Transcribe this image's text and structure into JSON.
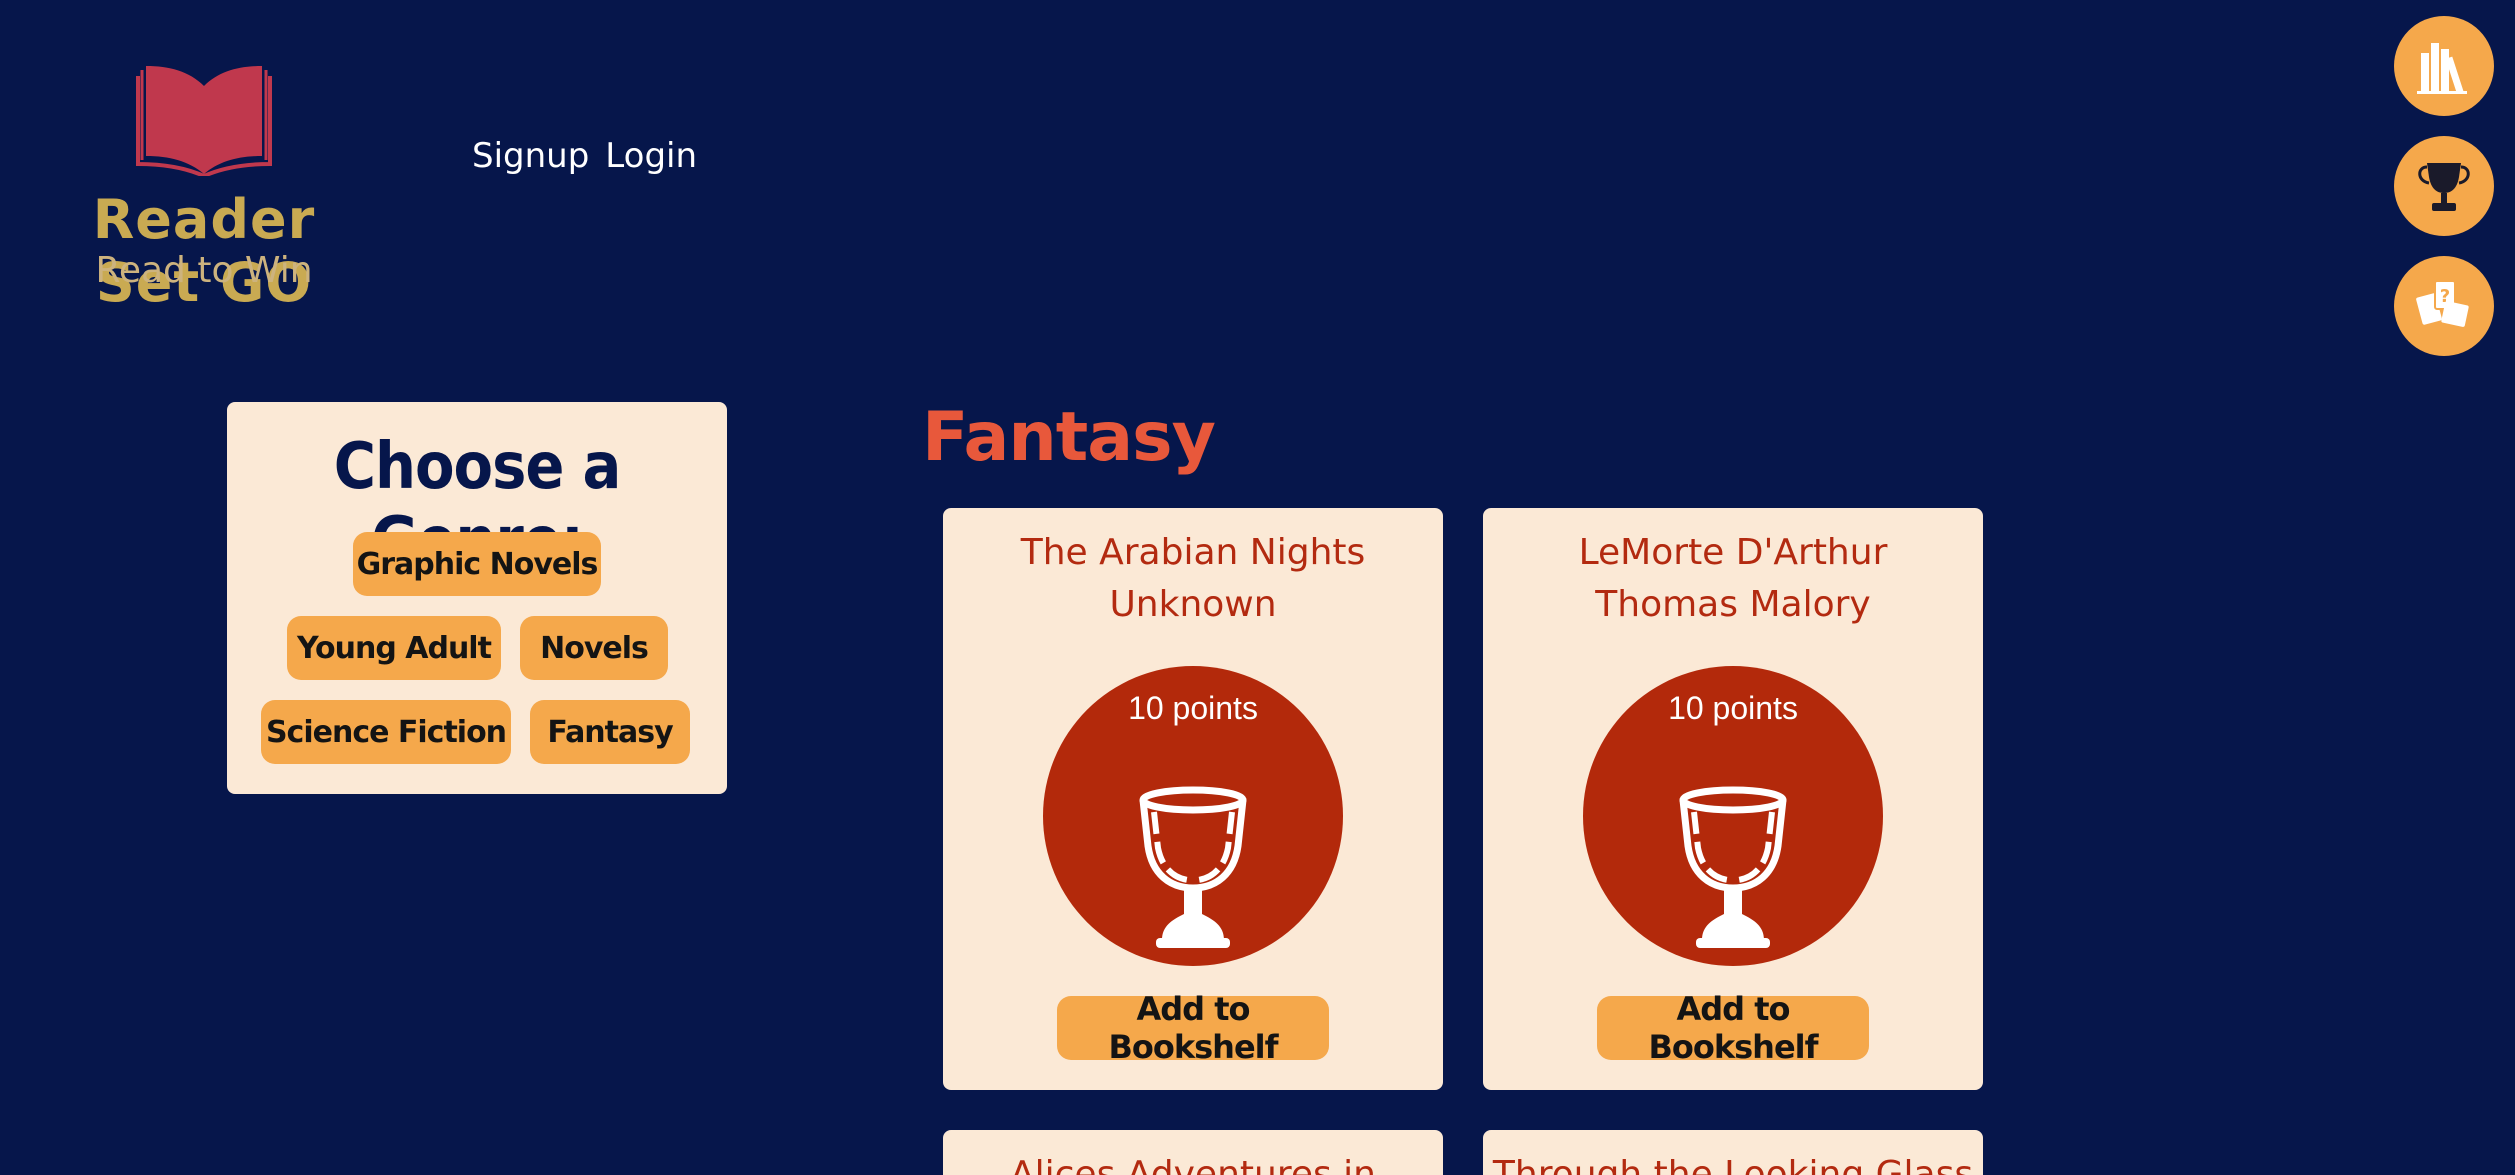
{
  "brand": {
    "title": "Reader Set GO",
    "subtitle": "Read to Win"
  },
  "nav": {
    "signup": "Signup",
    "login": "Login"
  },
  "side_icons": [
    "bookshelf-icon",
    "trophy-icon",
    "cards-icon"
  ],
  "genre_panel": {
    "title": "Choose a Genre:",
    "genres": [
      "Graphic Novels",
      "Young Adult",
      "Novels",
      "Science Fiction",
      "Fantasy"
    ]
  },
  "section": {
    "title": "Fantasy"
  },
  "books": [
    {
      "title": "The Arabian Nights",
      "author": "Unknown",
      "points": "10 points",
      "button": "Add to Bookshelf"
    },
    {
      "title": "LeMorte D'Arthur",
      "author": "Thomas Malory",
      "points": "10 points",
      "button": "Add to Bookshelf"
    },
    {
      "title": "Alices Adventures in",
      "author": "",
      "points": "",
      "button": ""
    },
    {
      "title": "Through the Looking Glass",
      "author": "",
      "points": "",
      "button": ""
    }
  ],
  "colors": {
    "background": "#06164b",
    "accent": "#f5a84b",
    "card": "#fbe9d6",
    "brand_red": "#b3290b",
    "heading": "#e8583b"
  }
}
